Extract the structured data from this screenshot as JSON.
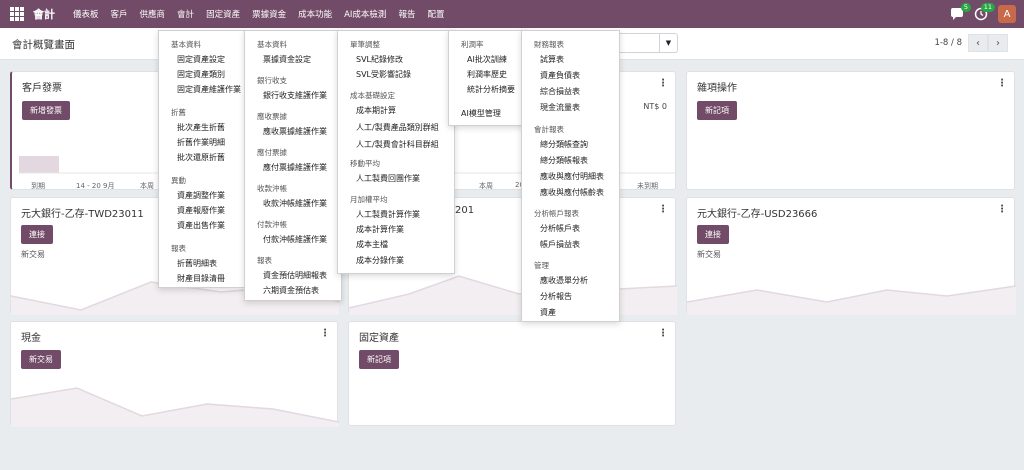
{
  "navbar": {
    "brand": "會計",
    "menu": [
      "儀表板",
      "客戶",
      "供應商",
      "會計",
      "固定資產",
      "票據資金",
      "成本功能",
      "AI成本檢測",
      "報告",
      "配置"
    ],
    "messages_badge": "5",
    "activity_badge": "11",
    "avatar": "A"
  },
  "control": {
    "title": "會計概覽畫面",
    "pager": "1-8 / 8",
    "prev": "‹",
    "next": "›"
  },
  "cards": {
    "customer_invoice": {
      "title": "客戶發票",
      "button": "新增發票",
      "amount": "NT$ 0",
      "labels": [
        "到期",
        "14 - 20 9月",
        "本周",
        "本周",
        "20",
        "未到期"
      ]
    },
    "misc": {
      "title": "雜項操作",
      "button": "新記項"
    },
    "bank_twd": {
      "title": "元大銀行-乙存-TWD23011",
      "button": "連接",
      "sub": "新交易"
    },
    "bank_201": {
      "title": "201"
    },
    "bank_usd": {
      "title": "元大銀行-乙存-USD23666",
      "button": "連接",
      "sub": "新交易"
    },
    "cash": {
      "title": "現金",
      "button": "新交易"
    },
    "fixed_assets": {
      "title": "固定資產",
      "button": "新記項"
    }
  },
  "dropdown": {
    "col1": {
      "sections": [
        {
          "title": "基本資料",
          "items": [
            "固定資產設定",
            "固定資產類別",
            "固定資產維護作業"
          ]
        },
        {
          "title": "折舊",
          "items": [
            "批次產生折舊",
            "折舊作業明細",
            "批次還原折舊"
          ]
        },
        {
          "title": "異動",
          "items": [
            "資產調整作業",
            "資產報廢作業",
            "資產出售作業"
          ]
        },
        {
          "title": "報表",
          "items": [
            "折舊明細表",
            "財產目錄清冊"
          ]
        }
      ]
    },
    "col2": {
      "sections": [
        {
          "title": "基本資料",
          "items": [
            "票據資金設定"
          ]
        },
        {
          "title": "銀行收支",
          "items": [
            "銀行收支維護作業"
          ]
        },
        {
          "title": "應收票據",
          "items": [
            "應收票據維護作業"
          ]
        },
        {
          "title": "應付票據",
          "items": [
            "應付票據維護作業"
          ]
        },
        {
          "title": "收款沖帳",
          "items": [
            "收款沖帳維護作業"
          ]
        },
        {
          "title": "付款沖帳",
          "items": [
            "付款沖帳維護作業"
          ]
        },
        {
          "title": "報表",
          "items": [
            "資金預估明細報表",
            "六期資金預估表"
          ]
        }
      ]
    },
    "col3": {
      "sections": [
        {
          "title": "單筆調整",
          "items": [
            "SVL紀錄修改",
            "SVL受影響記錄"
          ]
        },
        {
          "title": "成本基礎設定",
          "items": [
            "成本期計算",
            "人工/製費產品類別群組",
            "人工/製費會計科目群組"
          ]
        },
        {
          "title": "移動平均",
          "items": [
            "人工製費回團作業"
          ]
        },
        {
          "title": "月加權平均",
          "items": [
            "人工製費計算作業",
            "成本計算作業",
            "成本主檔",
            "成本分錄作業"
          ]
        }
      ]
    },
    "col4": {
      "sections": [
        {
          "title": "利潤率",
          "items": [
            "AI批次訓練",
            "利潤率歷史",
            "統計分析摘要"
          ]
        },
        {
          "title": "AI模型管理",
          "items": []
        }
      ]
    },
    "col5": {
      "sections": [
        {
          "title": "財務報表",
          "items": [
            "試算表",
            "資產負債表",
            "綜合損益表",
            "現金流量表"
          ]
        },
        {
          "title": "會計報表",
          "items": [
            "總分類帳查詢",
            "總分類帳報表",
            "應收與應付明細表",
            "應收與應付帳齡表"
          ]
        },
        {
          "title": "分析帳戶報表",
          "items": [
            "分析帳戶表",
            "帳戶損益表"
          ]
        },
        {
          "title": "管理",
          "items": [
            "應收憑單分析",
            "分析報告",
            "資產"
          ]
        }
      ]
    }
  }
}
